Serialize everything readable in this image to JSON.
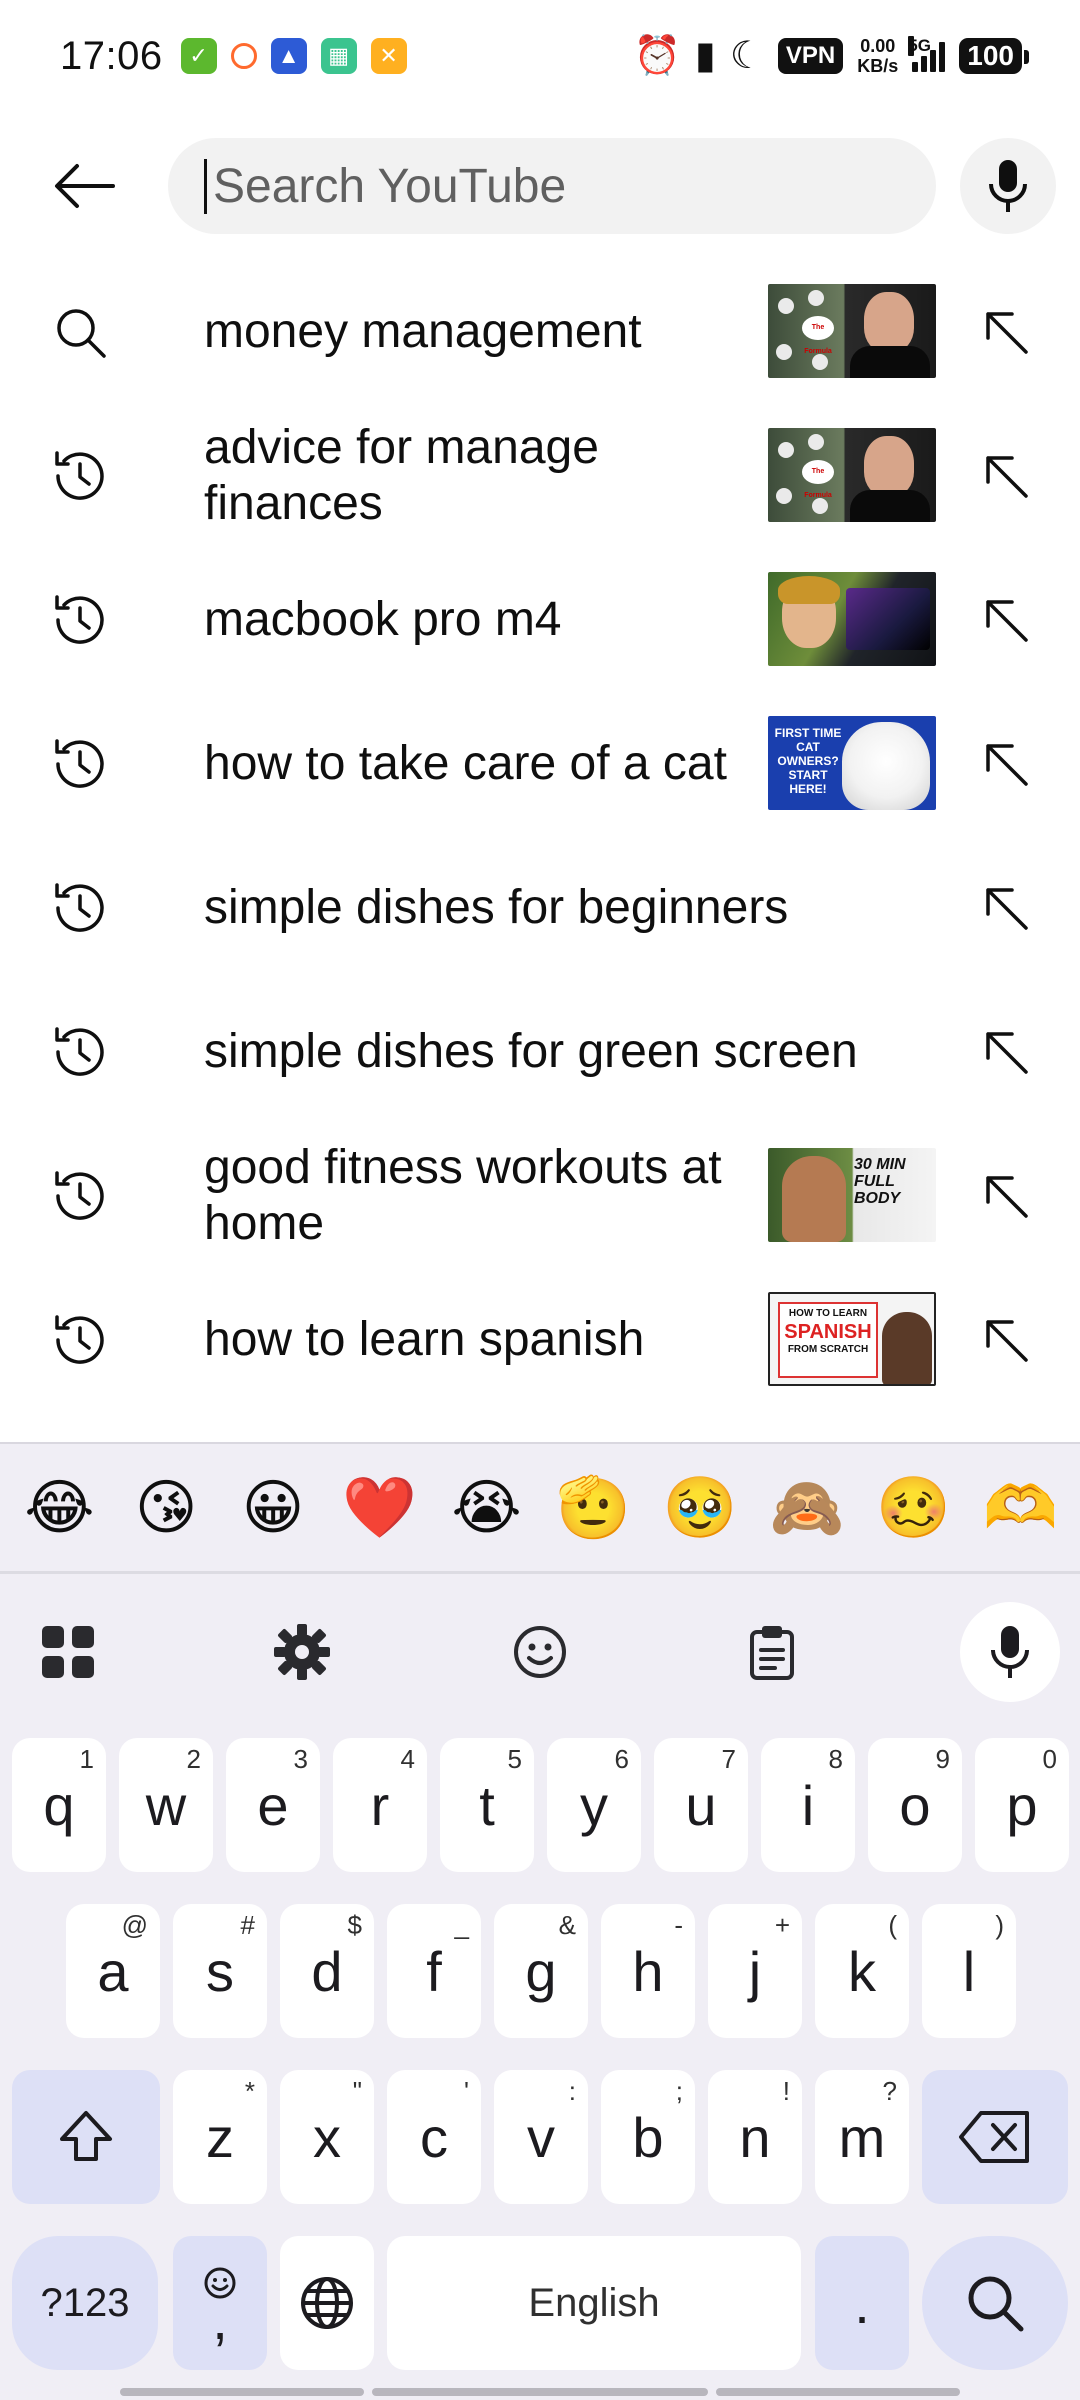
{
  "status_bar": {
    "time": "17:06",
    "vpn": "VPN",
    "net_speed_value": "0.00",
    "net_speed_unit": "KB/s",
    "signal_label": "5G",
    "battery": "100"
  },
  "search": {
    "placeholder": "Search YouTube",
    "value": ""
  },
  "suggestions": [
    {
      "icon": "search-icon",
      "text": "money management",
      "has_thumb": true
    },
    {
      "icon": "history-icon",
      "text": "advice for manage finances",
      "has_thumb": true
    },
    {
      "icon": "history-icon",
      "text": "macbook pro m4",
      "has_thumb": true
    },
    {
      "icon": "history-icon",
      "text": "how to take care of a cat",
      "has_thumb": true,
      "thumb_text": "FIRST TIME CAT OWNERS? START HERE!"
    },
    {
      "icon": "history-icon",
      "text": "simple dishes for beginners",
      "has_thumb": false
    },
    {
      "icon": "history-icon",
      "text": "simple dishes for green screen",
      "has_thumb": false
    },
    {
      "icon": "history-icon",
      "text": "good fitness workouts at home",
      "has_thumb": true,
      "thumb_text": "30 MIN FULL BODY"
    },
    {
      "icon": "history-icon",
      "text": "how to learn spanish",
      "has_thumb": true,
      "thumb_text_top": "HOW TO LEARN",
      "thumb_text_big": "SPANISH",
      "thumb_text_bottom": "FROM SCRATCH"
    }
  ],
  "thumb_money_label": "The Formula",
  "keyboard": {
    "emojis": [
      "😂",
      "😘",
      "😀",
      "❤️",
      "😭",
      "🫡",
      "🥹",
      "🙈",
      "🥴",
      "🫶"
    ],
    "row1": [
      {
        "k": "q",
        "s": "1"
      },
      {
        "k": "w",
        "s": "2"
      },
      {
        "k": "e",
        "s": "3"
      },
      {
        "k": "r",
        "s": "4"
      },
      {
        "k": "t",
        "s": "5"
      },
      {
        "k": "y",
        "s": "6"
      },
      {
        "k": "u",
        "s": "7"
      },
      {
        "k": "i",
        "s": "8"
      },
      {
        "k": "o",
        "s": "9"
      },
      {
        "k": "p",
        "s": "0"
      }
    ],
    "row2": [
      {
        "k": "a",
        "s": "@"
      },
      {
        "k": "s",
        "s": "#"
      },
      {
        "k": "d",
        "s": "$"
      },
      {
        "k": "f",
        "s": "_"
      },
      {
        "k": "g",
        "s": "&"
      },
      {
        "k": "h",
        "s": "-"
      },
      {
        "k": "j",
        "s": "+"
      },
      {
        "k": "k",
        "s": "("
      },
      {
        "k": "l",
        "s": ")"
      }
    ],
    "row3": [
      {
        "k": "z",
        "s": "*"
      },
      {
        "k": "x",
        "s": "\""
      },
      {
        "k": "c",
        "s": "'"
      },
      {
        "k": "v",
        "s": ":"
      },
      {
        "k": "b",
        "s": ";"
      },
      {
        "k": "n",
        "s": "!"
      },
      {
        "k": "m",
        "s": "?"
      }
    ],
    "symbols_key": "?123",
    "comma_key": ",",
    "space_label": "English",
    "period_key": "."
  }
}
